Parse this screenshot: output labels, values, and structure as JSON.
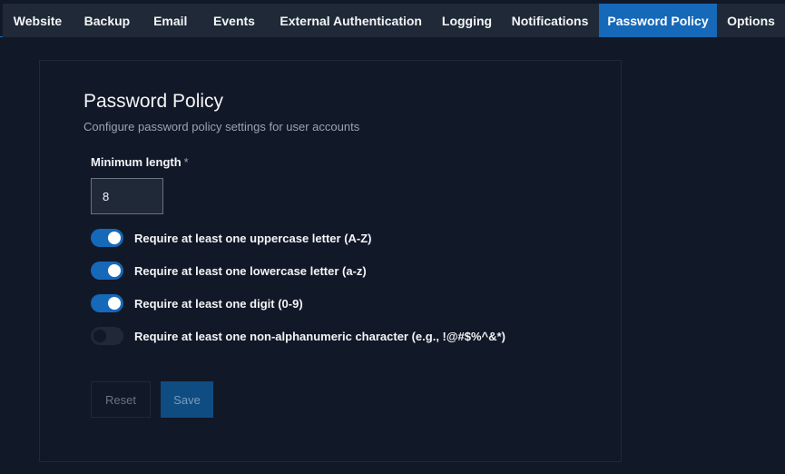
{
  "tabs": [
    {
      "label": "Website",
      "active": false
    },
    {
      "label": "Backup",
      "active": false
    },
    {
      "label": "Email",
      "active": false
    },
    {
      "label": "Events",
      "active": false
    },
    {
      "label": "External Authentication",
      "active": false
    },
    {
      "label": "Logging",
      "active": false
    },
    {
      "label": "Notifications",
      "active": false
    },
    {
      "label": "Password Policy",
      "active": true
    },
    {
      "label": "Options",
      "active": false
    }
  ],
  "panel": {
    "title": "Password Policy",
    "subtitle": "Configure password policy settings for user accounts",
    "min_length": {
      "label": "Minimum length",
      "required_marker": "*",
      "value": "8"
    },
    "toggles": [
      {
        "label": "Require at least one uppercase letter (A-Z)",
        "checked": true
      },
      {
        "label": "Require at least one lowercase letter (a-z)",
        "checked": true
      },
      {
        "label": "Require at least one digit (0-9)",
        "checked": true
      },
      {
        "label": "Require at least one non-alphanumeric character (e.g., !@#$%^&*)",
        "checked": false
      }
    ],
    "buttons": {
      "reset": "Reset",
      "save": "Save"
    }
  },
  "colors": {
    "background": "#111827",
    "tabbar": "#1f2937",
    "accent": "#1668b8"
  }
}
